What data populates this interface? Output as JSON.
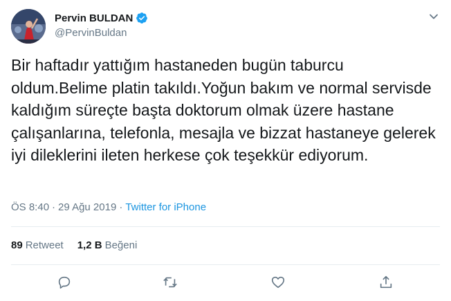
{
  "author": {
    "display_name": "Pervin BULDAN",
    "handle": "@PervinBuldan",
    "verified": true
  },
  "tweet": {
    "text": "Bir haftadır yattığım hastaneden bugün taburcu oldum.Belime platin takıldı.Yoğun bakım ve normal servisde kaldığım süreçte başta doktorum olmak üzere hastane çalışanlarına, telefonla, mesajla ve bizzat hastaneye gelerek iyi dileklerini ileten herkese çok teşekkür ediyorum.",
    "time": "ÖS 8:40",
    "separator": "·",
    "date": "29 Ağu 2019",
    "source": "Twitter for iPhone"
  },
  "stats": {
    "retweets_count": "89",
    "retweets_label": "Retweet",
    "likes_count": "1,2 B",
    "likes_label": "Beğeni"
  },
  "icons": {
    "verified": "verified-badge-icon",
    "more": "chevron-down-icon",
    "reply": "reply-icon",
    "retweet": "retweet-icon",
    "like": "heart-icon",
    "share": "share-icon"
  },
  "colors": {
    "link": "#1b95e0",
    "secondary_text": "#657786",
    "primary_text": "#14171a",
    "divider": "#e6ecf0"
  }
}
